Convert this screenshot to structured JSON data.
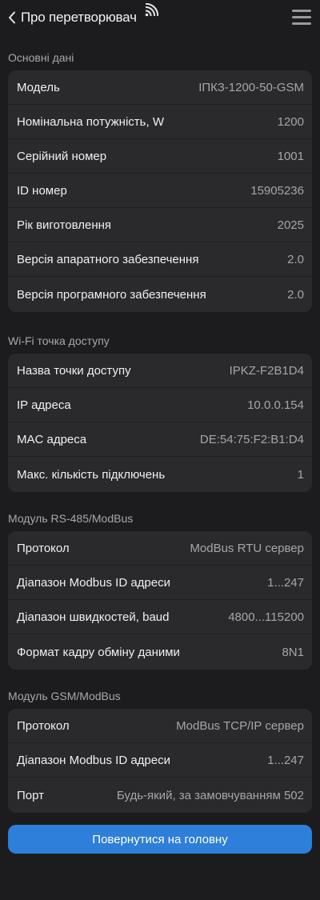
{
  "header": {
    "title": "Про перетворювач",
    "back_icon": "chevron-left-icon",
    "status_icon": "wifi-icon",
    "menu_icon": "hamburger-menu-icon"
  },
  "sections": [
    {
      "title": "Основні дані",
      "rows": [
        {
          "label": "Модель",
          "value": "ІПКЗ-1200-50-GSM"
        },
        {
          "label": "Номінальна потужність, W",
          "value": "1200"
        },
        {
          "label": "Серійний номер",
          "value": "1001"
        },
        {
          "label": "ID номер",
          "value": "15905236"
        },
        {
          "label": "Рік виготовлення",
          "value": "2025"
        },
        {
          "label": "Версія апаратного забезпечення",
          "value": "2.0"
        },
        {
          "label": "Версія програмного забезпечення",
          "value": "2.0"
        }
      ]
    },
    {
      "title": "Wi-Fi точка доступу",
      "rows": [
        {
          "label": "Назва точки доступу",
          "value": "IPKZ-F2B1D4"
        },
        {
          "label": "IP адреса",
          "value": "10.0.0.154"
        },
        {
          "label": "MAC адреса",
          "value": "DE:54:75:F2:B1:D4"
        },
        {
          "label": "Макс. кількість підключень",
          "value": "1"
        }
      ]
    },
    {
      "title": "Модуль RS-485/ModBus",
      "rows": [
        {
          "label": "Протокол",
          "value": "ModBus RTU сервер"
        },
        {
          "label": "Діапазон Modbus ID адреси",
          "value": "1...247"
        },
        {
          "label": "Діапазон швидкостей, baud",
          "value": "4800...115200"
        },
        {
          "label": "Формат кадру обміну даними",
          "value": "8N1"
        }
      ]
    },
    {
      "title": "Модуль GSM/ModBus",
      "rows": [
        {
          "label": "Протокол",
          "value": "ModBus TCP/IP сервер"
        },
        {
          "label": "Діапазон Modbus ID адреси",
          "value": "1...247"
        },
        {
          "label": "Порт",
          "value": "Будь-який, за замовчуванням 502"
        }
      ]
    }
  ],
  "footer": {
    "home_button_label": "Повернутися на головну"
  },
  "colors": {
    "background": "#1c1c1e",
    "card": "#2a2a2c",
    "accent": "#2d7fd9"
  }
}
